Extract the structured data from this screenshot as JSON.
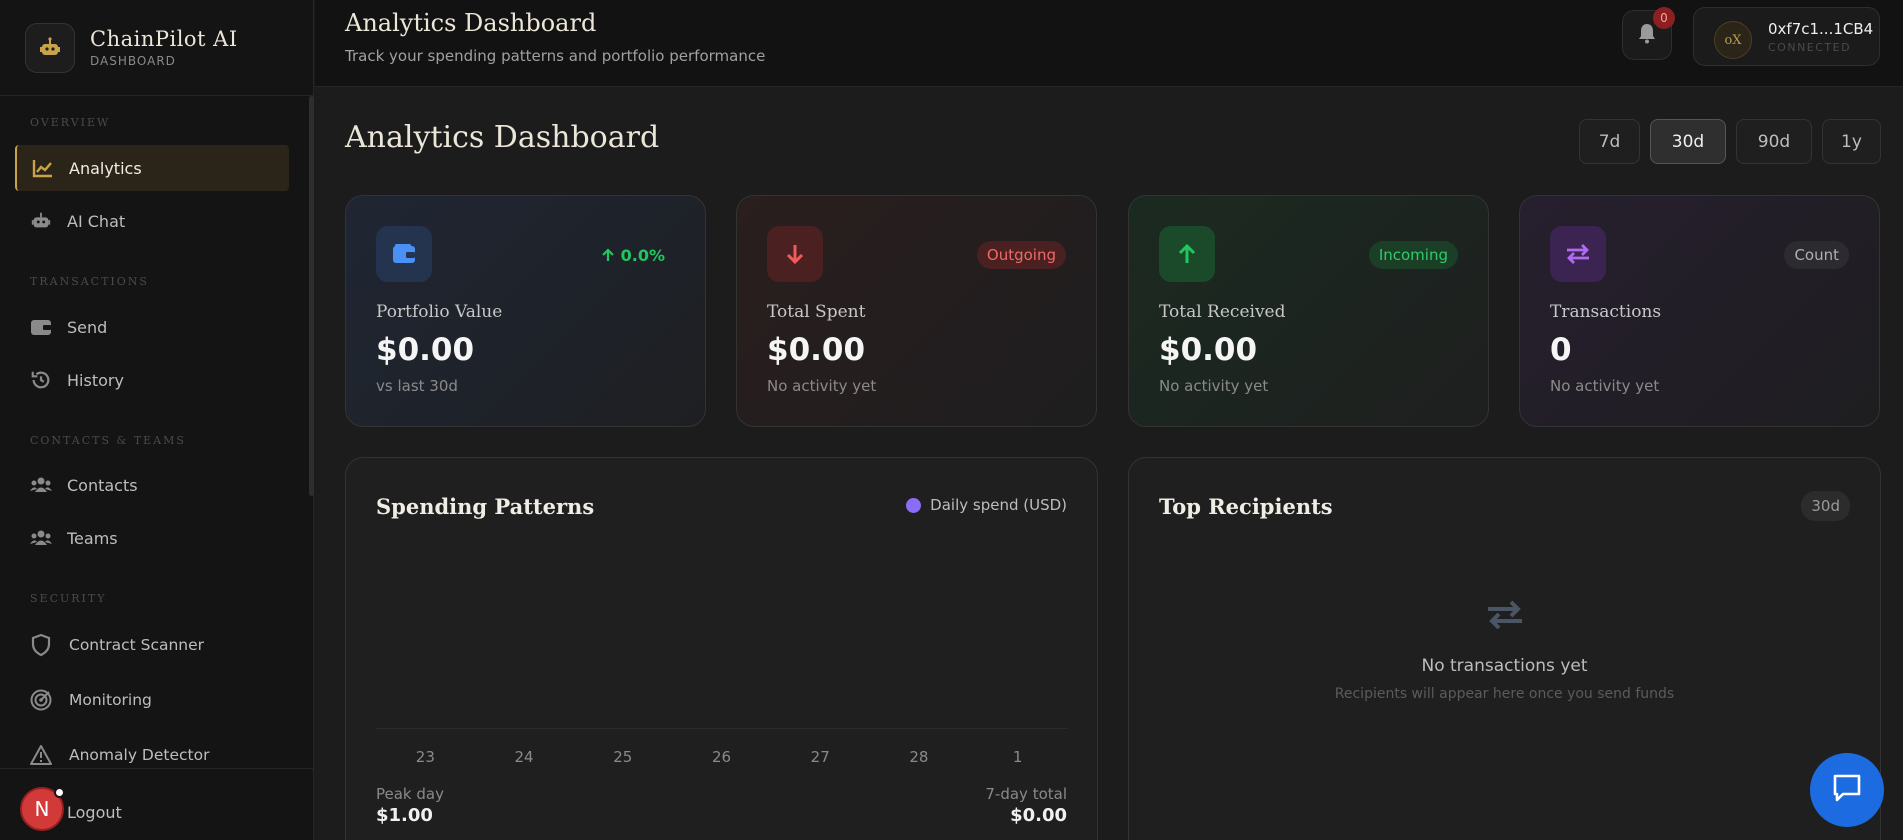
{
  "brand": {
    "name": "ChainPilot AI",
    "subtitle": "DASHBOARD",
    "logo_icon": "robot-icon"
  },
  "sidebar": {
    "sections": [
      "OVERVIEW",
      "TRANSACTIONS",
      "CONTACTS & TEAMS",
      "SECURITY"
    ],
    "items": [
      {
        "label": "Analytics",
        "icon": "chart-line-icon",
        "active": true
      },
      {
        "label": "AI Chat",
        "icon": "robot-icon"
      },
      {
        "label": "Send",
        "icon": "wallet-icon"
      },
      {
        "label": "History",
        "icon": "history-icon"
      },
      {
        "label": "Contacts",
        "icon": "users-icon"
      },
      {
        "label": "Teams",
        "icon": "users-icon"
      },
      {
        "label": "Contract Scanner",
        "icon": "shield-icon"
      },
      {
        "label": "Monitoring",
        "icon": "radar-icon"
      },
      {
        "label": "Anomaly Detector",
        "icon": "warning-icon"
      }
    ],
    "footer": {
      "avatar_initial": "N",
      "logout_label": "Logout"
    }
  },
  "topbar": {
    "title": "Analytics Dashboard",
    "subtitle": "Track your spending patterns and portfolio performance",
    "notification_count": "0",
    "wallet": {
      "avatar_text": "oX",
      "address": "0xf7c1...1CB4",
      "status": "CONNECTED"
    }
  },
  "main": {
    "title": "Analytics Dashboard",
    "ranges": [
      "7d",
      "30d",
      "90d",
      "1y"
    ],
    "active_range": "30d",
    "cards": [
      {
        "icon": "wallet-icon",
        "tag": "0.0%",
        "tag_icon": "arrow-up-icon",
        "label": "Portfolio Value",
        "value": "$0.00",
        "note": "vs last 30d"
      },
      {
        "icon": "arrow-down-icon",
        "tag": "Outgoing",
        "label": "Total Spent",
        "value": "$0.00",
        "note": "No activity yet"
      },
      {
        "icon": "arrow-up-icon",
        "tag": "Incoming",
        "label": "Total Received",
        "value": "$0.00",
        "note": "No activity yet"
      },
      {
        "icon": "swap-icon",
        "tag": "Count",
        "label": "Transactions",
        "value": "0",
        "note": "No activity yet"
      }
    ],
    "spending": {
      "title": "Spending Patterns",
      "legend": "Daily spend (USD)",
      "peak_label": "Peak day",
      "peak_value": "$1.00",
      "total_label": "7-day total",
      "total_value": "$0.00"
    },
    "recipients": {
      "title": "Top Recipients",
      "badge": "30d",
      "empty_title": "No transactions yet",
      "empty_sub": "Recipients will appear here once you send funds"
    }
  },
  "chart_data": {
    "type": "bar",
    "title": "Spending Patterns",
    "categories": [
      "23",
      "24",
      "25",
      "26",
      "27",
      "28",
      "1"
    ],
    "series": [
      {
        "name": "Daily spend (USD)",
        "values": [
          0,
          0,
          0,
          0,
          0,
          0,
          0
        ]
      }
    ],
    "legend": "top-right",
    "colors": {
      "series": "#8b6cf6"
    }
  },
  "colors": {
    "accent_gold": "#c9a24a",
    "blue": "#4a90f5",
    "red": "#f05a5a",
    "green": "#22c55e",
    "purple": "#b06cf0",
    "fab": "#1c6be0"
  }
}
